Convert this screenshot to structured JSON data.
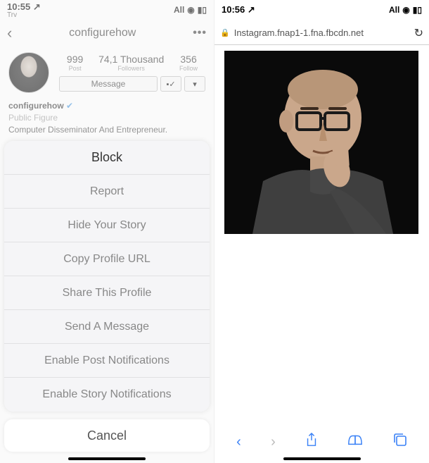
{
  "left": {
    "status": {
      "time": "10:55",
      "net": "All",
      "try": "Trv"
    },
    "nav": {
      "title": "configurehow"
    },
    "profile": {
      "posts": {
        "num": "999",
        "label": "Post"
      },
      "followers": {
        "num": "74,1 Thousand",
        "label": "Followers"
      },
      "following": {
        "num": "356",
        "label": "Follow"
      },
      "message_btn": "Message",
      "username": "configurehow",
      "category": "Public Figure",
      "bio": "Computer Disseminator And Entrepreneur."
    },
    "sheet": {
      "block": "Block",
      "report": "Report",
      "hide_story": "Hide Your Story",
      "copy_url": "Copy Profile URL",
      "share": "Share This Profile",
      "send_msg": "Send A Message",
      "post_notif": "Enable Post Notifications",
      "story_notif": "Enable Story Notifications"
    },
    "cancel": "Cancel"
  },
  "right": {
    "status": {
      "time": "10:56",
      "net": "All"
    },
    "url": "Instagram.fnap1-1.fna.fbcdn.net"
  }
}
